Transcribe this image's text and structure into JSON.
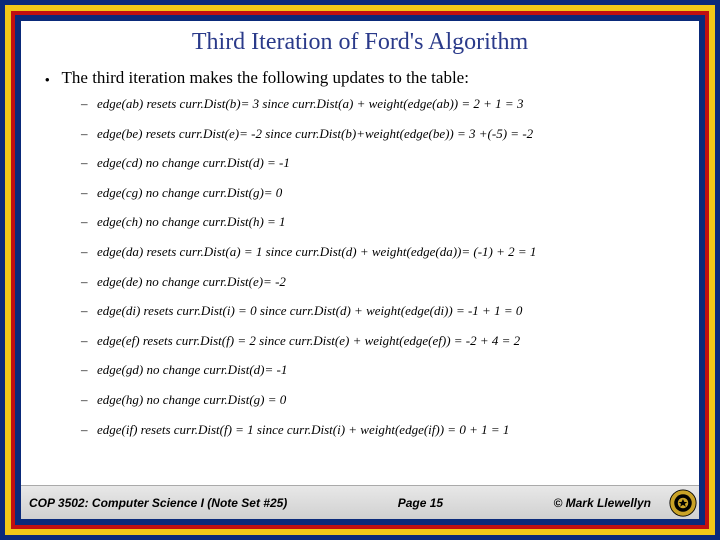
{
  "title": "Third Iteration of Ford's Algorithm",
  "intro": "The third iteration makes the following updates to the table:",
  "items": [
    "edge(ab) resets curr.Dist(b)= 3 since curr.Dist(a) + weight(edge(ab)) = 2 + 1 = 3",
    "edge(be) resets curr.Dist(e)= -2 since curr.Dist(b)+weight(edge(be)) = 3 +(-5) = -2",
    "edge(cd) no change curr.Dist(d) = -1",
    "edge(cg) no change curr.Dist(g)= 0",
    "edge(ch) no change curr.Dist(h) = 1",
    "edge(da) resets curr.Dist(a) = 1 since curr.Dist(d) + weight(edge(da))= (-1) + 2 = 1",
    "edge(de) no change curr.Dist(e)= -2",
    "edge(di) resets curr.Dist(i) = 0 since curr.Dist(d) + weight(edge(di)) = -1 + 1 = 0",
    "edge(ef) resets curr.Dist(f) = 2 since curr.Dist(e) + weight(edge(ef)) = -2 + 4 = 2",
    "edge(gd) no change curr.Dist(d)= -1",
    "edge(hg) no change curr.Dist(g) = 0",
    "edge(if) resets curr.Dist(f) = 1 since curr.Dist(i) + weight(edge(if)) = 0 + 1 = 1"
  ],
  "footer": {
    "left": "COP 3502: Computer Science I  (Note Set #25)",
    "center": "Page 15",
    "right": "© Mark Llewellyn"
  }
}
